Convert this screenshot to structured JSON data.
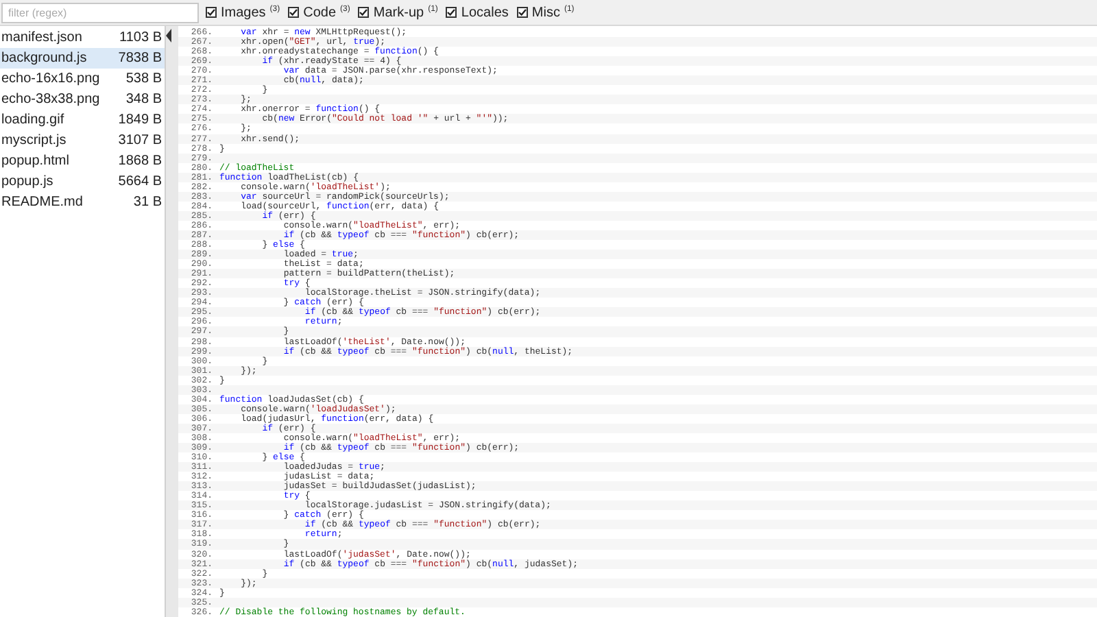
{
  "filter": {
    "placeholder": "filter (regex)"
  },
  "categories": [
    {
      "label": "Images",
      "count": "(3)",
      "checked": true
    },
    {
      "label": "Code",
      "count": "(3)",
      "checked": true
    },
    {
      "label": "Mark-up",
      "count": "(1)",
      "checked": true
    },
    {
      "label": "Locales",
      "checked": true
    },
    {
      "label": "Misc",
      "count": "(1)",
      "checked": true
    }
  ],
  "files": [
    {
      "name": "manifest.json",
      "size": "1103 B",
      "selected": false
    },
    {
      "name": "background.js",
      "size": "7838 B",
      "selected": true
    },
    {
      "name": "echo-16x16.png",
      "size": "538 B",
      "selected": false
    },
    {
      "name": "echo-38x38.png",
      "size": "348 B",
      "selected": false
    },
    {
      "name": "loading.gif",
      "size": "1849 B",
      "selected": false
    },
    {
      "name": "myscript.js",
      "size": "3107 B",
      "selected": false
    },
    {
      "name": "popup.html",
      "size": "1868 B",
      "selected": false
    },
    {
      "name": "popup.js",
      "size": "5664 B",
      "selected": false
    },
    {
      "name": "README.md",
      "size": "31 B",
      "selected": false
    }
  ],
  "code_lines": [
    {
      "number": "266.",
      "text": "    var xhr = new XMLHttpRequest();"
    },
    {
      "number": "267.",
      "text": "    xhr.open(\"GET\", url, true);"
    },
    {
      "number": "268.",
      "text": "    xhr.onreadystatechange = function() {"
    },
    {
      "number": "269.",
      "text": "        if (xhr.readyState == 4) {"
    },
    {
      "number": "270.",
      "text": "            var data = JSON.parse(xhr.responseText);"
    },
    {
      "number": "271.",
      "text": "            cb(null, data);"
    },
    {
      "number": "272.",
      "text": "        }"
    },
    {
      "number": "273.",
      "text": "    };"
    },
    {
      "number": "274.",
      "text": "    xhr.onerror = function() {"
    },
    {
      "number": "275.",
      "text": "        cb(new Error(\"Could not load '\" + url + \"'\"));"
    },
    {
      "number": "276.",
      "text": "    };"
    },
    {
      "number": "277.",
      "text": "    xhr.send();"
    },
    {
      "number": "278.",
      "text": "}"
    },
    {
      "number": "279."
    },
    {
      "number": "280.",
      "text": "// loadTheList"
    },
    {
      "number": "281.",
      "text": "function loadTheList(cb) {"
    },
    {
      "number": "282.",
      "text": "    console.warn('loadTheList');"
    },
    {
      "number": "283.",
      "text": "    var sourceUrl = randomPick(sourceUrls);"
    },
    {
      "number": "284.",
      "text": "    load(sourceUrl, function(err, data) {"
    },
    {
      "number": "285.",
      "text": "        if (err) {"
    },
    {
      "number": "286.",
      "text": "            console.warn(\"loadTheList\", err);"
    },
    {
      "number": "287.",
      "text": "            if (cb && typeof cb === \"function\") cb(err);"
    },
    {
      "number": "288.",
      "text": "        } else {"
    },
    {
      "number": "289.",
      "text": "            loaded = true;"
    },
    {
      "number": "290.",
      "text": "            theList = data;"
    },
    {
      "number": "291.",
      "text": "            pattern = buildPattern(theList);"
    },
    {
      "number": "292.",
      "text": "            try {"
    },
    {
      "number": "293.",
      "text": "                localStorage.theList = JSON.stringify(data);"
    },
    {
      "number": "294.",
      "text": "            } catch (err) {"
    },
    {
      "number": "295.",
      "text": "                if (cb && typeof cb === \"function\") cb(err);"
    },
    {
      "number": "296.",
      "text": "                return;"
    },
    {
      "number": "297.",
      "text": "            }"
    },
    {
      "number": "298.",
      "text": "            lastLoadOf('theList', Date.now());"
    },
    {
      "number": "299.",
      "text": "            if (cb && typeof cb === \"function\") cb(null, theList);"
    },
    {
      "number": "300.",
      "text": "        }"
    },
    {
      "number": "301.",
      "text": "    });"
    },
    {
      "number": "302.",
      "text": "}"
    },
    {
      "number": "303."
    },
    {
      "number": "304.",
      "text": "function loadJudasSet(cb) {"
    },
    {
      "number": "305.",
      "text": "    console.warn('loadJudasSet');"
    },
    {
      "number": "306.",
      "text": "    load(judasUrl, function(err, data) {"
    },
    {
      "number": "307.",
      "text": "        if (err) {"
    },
    {
      "number": "308.",
      "text": "            console.warn(\"loadTheList\", err);"
    },
    {
      "number": "309.",
      "text": "            if (cb && typeof cb === \"function\") cb(err);"
    },
    {
      "number": "310.",
      "text": "        } else {"
    },
    {
      "number": "311.",
      "text": "            loadedJudas = true;"
    },
    {
      "number": "312.",
      "text": "            judasList = data;"
    },
    {
      "number": "313.",
      "text": "            judasSet = buildJudasSet(judasList);"
    },
    {
      "number": "314.",
      "text": "            try {"
    },
    {
      "number": "315.",
      "text": "                localStorage.judasList = JSON.stringify(data);"
    },
    {
      "number": "316.",
      "text": "            } catch (err) {"
    },
    {
      "number": "317.",
      "text": "                if (cb && typeof cb === \"function\") cb(err);"
    },
    {
      "number": "318.",
      "text": "                return;"
    },
    {
      "number": "319.",
      "text": "            }"
    },
    {
      "number": "320.",
      "text": "            lastLoadOf('judasSet', Date.now());"
    },
    {
      "number": "321.",
      "text": "            if (cb && typeof cb === \"function\") cb(null, judasSet);"
    },
    {
      "number": "322.",
      "text": "        }"
    },
    {
      "number": "323.",
      "text": "    });"
    },
    {
      "number": "324.",
      "text": "}"
    },
    {
      "number": "325."
    },
    {
      "number": "326.",
      "text": "// Disable the following hostnames by default."
    }
  ]
}
